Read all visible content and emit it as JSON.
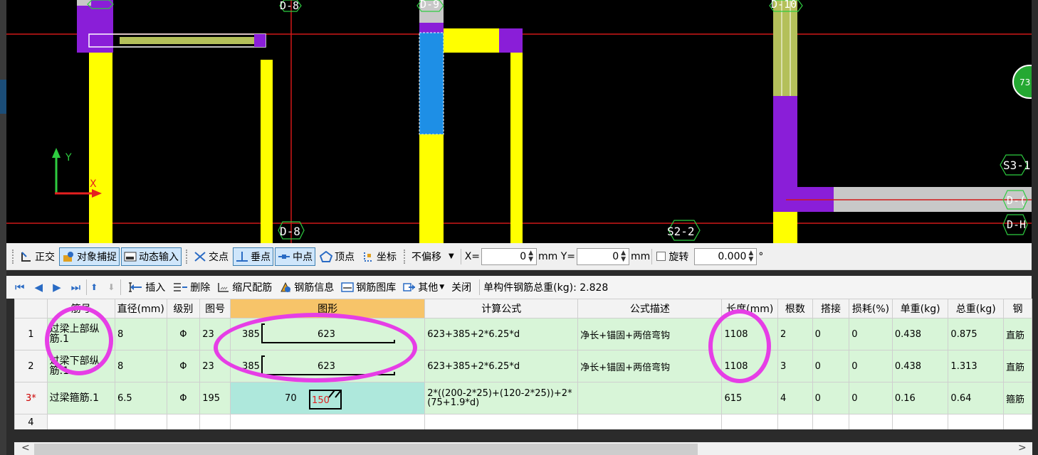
{
  "cad": {
    "labels": {
      "d8_top": "D-8",
      "d9_top": "D-9",
      "d10_top": "D-10",
      "d8_bottom": "D-8",
      "s2_2": "S2-2",
      "s3_1": "S3-1",
      "d_right": "D-(",
      "d_h": "D-H",
      "badge": "73",
      "axis_y": "Y",
      "axis_x": "X"
    }
  },
  "toolbar1": {
    "ortho": "正交",
    "snap": "对象捕捉",
    "dyn_input": "动态输入",
    "intersection": "交点",
    "perpendicular": "垂点",
    "midpoint": "中点",
    "vertex": "顶点",
    "coordinate": "坐标",
    "offset_mode": "不偏移",
    "x_label": "X=",
    "x_value": "0",
    "x_unit": "mm Y=",
    "y_value": "0",
    "y_unit": "mm",
    "rotate": "旋转",
    "rotate_value": "0.000",
    "degree": "°"
  },
  "toolbar2": {
    "insert": "插入",
    "delete": "删除",
    "scale_rebar": "缩尺配筋",
    "rebar_info": "钢筋信息",
    "rebar_library": "钢筋图库",
    "other": "其他",
    "close": "关闭",
    "total_weight": "单构件钢筋总重(kg): 2.828"
  },
  "table": {
    "headers": [
      "筋号",
      "直径(mm)",
      "级别",
      "图号",
      "图形",
      "计算公式",
      "公式描述",
      "长度(mm)",
      "根数",
      "搭接",
      "损耗(%)",
      "单重(kg)",
      "总重(kg)",
      "钢"
    ],
    "rows": [
      {
        "num": "1",
        "name": "过梁上部纵筋.1",
        "dia": "8",
        "grade": "Φ",
        "fig": "23",
        "shape_left": "385",
        "shape_main": "623",
        "formula": "623+385+2*6.25*d",
        "desc": "净长+锚固+两倍弯钩",
        "length": "1108",
        "count": "2",
        "lap": "0",
        "loss": "0",
        "unit_w": "0.438",
        "total_w": "0.875",
        "type": "直筋"
      },
      {
        "num": "2",
        "name": "过梁下部纵筋.1",
        "dia": "8",
        "grade": "Φ",
        "fig": "23",
        "shape_left": "385",
        "shape_main": "623",
        "formula": "623+385+2*6.25*d",
        "desc": "净长+锚固+两倍弯钩",
        "length": "1108",
        "count": "3",
        "lap": "0",
        "loss": "0",
        "unit_w": "0.438",
        "total_w": "1.313",
        "type": "直筋"
      },
      {
        "num": "3*",
        "name": "过梁箍筋.1",
        "dia": "6.5",
        "grade": "Φ",
        "fig": "195",
        "shape_left": "70",
        "shape_main": "150",
        "formula": "2*((200-2*25)+(120-2*25))+2*(75+1.9*d)",
        "desc": "",
        "length": "615",
        "count": "4",
        "lap": "0",
        "loss": "0",
        "unit_w": "0.16",
        "total_w": "0.64",
        "type": "箍筋"
      },
      {
        "num": "4"
      }
    ]
  },
  "colors": {
    "annotation": "#e63ee6",
    "row_green": "#d8f5d8",
    "header_selected": "#f7c469"
  }
}
